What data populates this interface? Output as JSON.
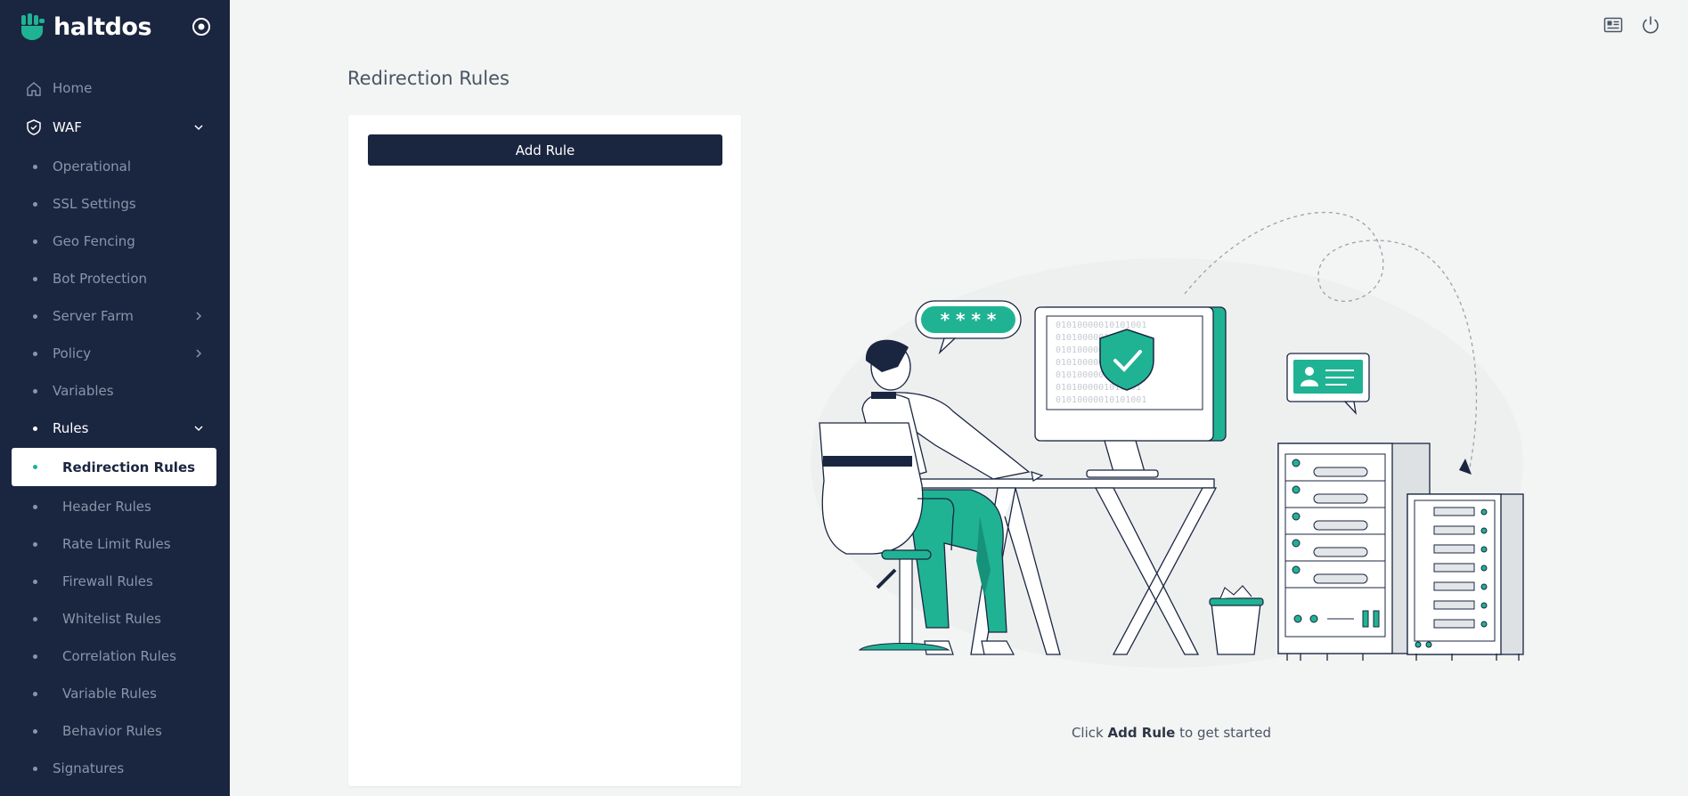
{
  "brand": {
    "name": "haltdos"
  },
  "sidebar": {
    "items": [
      {
        "label": "Home",
        "icon": "home-icon"
      },
      {
        "label": "WAF",
        "icon": "shield-check-icon"
      },
      {
        "label": "Operational"
      },
      {
        "label": "SSL Settings"
      },
      {
        "label": "Geo Fencing"
      },
      {
        "label": "Bot Protection"
      },
      {
        "label": "Server Farm"
      },
      {
        "label": "Policy"
      },
      {
        "label": "Variables"
      },
      {
        "label": "Rules"
      },
      {
        "label": "Redirection Rules"
      },
      {
        "label": "Header Rules"
      },
      {
        "label": "Rate Limit Rules"
      },
      {
        "label": "Firewall Rules"
      },
      {
        "label": "Whitelist Rules"
      },
      {
        "label": "Correlation Rules"
      },
      {
        "label": "Variable Rules"
      },
      {
        "label": "Behavior Rules"
      },
      {
        "label": "Signatures"
      }
    ]
  },
  "main": {
    "title": "Redirection Rules",
    "add_rule_label": "Add Rule",
    "hint_prefix": "Click",
    "hint_bold": "Add Rule",
    "hint_suffix": "to get started"
  },
  "illustration": {
    "password_bubble": "* * * *",
    "binary_lines": [
      "01010000010101001",
      "0101000001010001",
      "01010000010101001",
      "0101000001010001",
      "01010000010101001",
      "0101000001010001",
      "01010000010101001"
    ]
  },
  "colors": {
    "sidebar_bg": "#1a2540",
    "accent": "#1fb394",
    "page_bg": "#f3f4f4"
  }
}
